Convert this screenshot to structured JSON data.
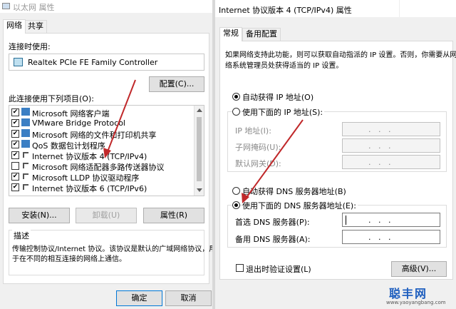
{
  "left_window": {
    "title": "以太网 属性",
    "tabs": [
      "网络",
      "共享"
    ],
    "connect_using_label": "连接时使用:",
    "adapter_name": "Realtek PCIe FE Family Controller",
    "configure_button": "配置(C)...",
    "items_label": "此连接使用下列项目(O):",
    "items": [
      {
        "label": "Microsoft 网络客户端",
        "checked": true,
        "icon": "network-icon"
      },
      {
        "label": "VMware Bridge Protocol",
        "checked": true,
        "icon": "network-icon"
      },
      {
        "label": "Microsoft 网络的文件和打印机共享",
        "checked": true,
        "icon": "network-icon"
      },
      {
        "label": "QoS 数据包计划程序",
        "checked": true,
        "icon": "network-icon"
      },
      {
        "label": "Internet 协议版本 4 (TCP/IPv4)",
        "checked": true,
        "icon": "protocol-icon"
      },
      {
        "label": "Microsoft 网络适配器多路传送器协议",
        "checked": false,
        "icon": "protocol-icon"
      },
      {
        "label": "Microsoft LLDP 协议驱动程序",
        "checked": true,
        "icon": "protocol-icon"
      },
      {
        "label": "Internet 协议版本 6 (TCP/IPv6)",
        "checked": true,
        "icon": "protocol-icon"
      }
    ],
    "install_button": "安装(N)...",
    "uninstall_button": "卸载(U)",
    "properties_button": "属性(R)",
    "description_label": "描述",
    "description_text_1": "传输控制协议/Internet 协议。该协议是默认的广域网络协议，用",
    "description_text_2": "于在不同的相互连接的网络上通信。",
    "ok_button": "确定",
    "cancel_button": "取消"
  },
  "right_window": {
    "title": "Internet 协议版本 4 (TCP/IPv4) 属性",
    "tabs": [
      "常规",
      "备用配置"
    ],
    "intro_line_1": "如果网络支持此功能，则可以获取自动指派的 IP 设置。否则，你需要从网",
    "intro_line_2": "络系统管理员处获得适当的 IP 设置。",
    "auto_ip_label": "自动获得 IP 地址(O)",
    "manual_ip_label": "使用下面的 IP 地址(S):",
    "ip_address_label": "IP 地址(I):",
    "subnet_label": "子网掩码(U):",
    "gateway_label": "默认网关(D):",
    "auto_dns_label": "自动获得 DNS 服务器地址(B)",
    "manual_dns_label": "使用下面的 DNS 服务器地址(E):",
    "preferred_dns_label": "首选 DNS 服务器(P):",
    "alternate_dns_label": "备用 DNS 服务器(A):",
    "validate_label": "退出时验证设置(L)",
    "advanced_button": "高级(V)...",
    "ip_placeholder_dots": ".   .   ."
  },
  "watermark": {
    "brand": "聪丰网",
    "url": "www.yaoyangbang.com"
  },
  "colors": {
    "arrow": "#c0282a",
    "accent": "#0078d7"
  }
}
